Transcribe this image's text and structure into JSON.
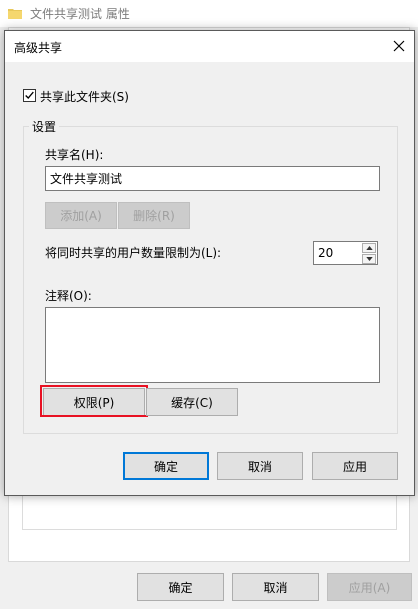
{
  "background": {
    "title": "文件共享测试 属性",
    "buttons": {
      "ok": "确定",
      "cancel": "取消",
      "apply": "应用(A)"
    }
  },
  "dialog": {
    "title": "高级共享",
    "share_checkbox_label": "共享此文件夹(S)",
    "share_checked": true,
    "settings_label": "设置",
    "share_name_label": "共享名(H):",
    "share_name_value": "文件共享测试",
    "add_button": "添加(A)",
    "remove_button": "删除(R)",
    "user_limit_label": "将同时共享的用户数量限制为(L):",
    "user_limit_value": "20",
    "comment_label": "注释(O):",
    "comment_value": "",
    "permissions_button": "权限(P)",
    "cache_button": "缓存(C)",
    "ok_button": "确定",
    "cancel_button": "取消",
    "apply_button": "应用"
  },
  "colors": {
    "accent": "#0078d7",
    "highlight": "#e81123"
  },
  "icons": {
    "folder": "folder-icon",
    "close": "close-icon",
    "check": "check-icon",
    "up": "arrow-up-icon",
    "down": "arrow-down-icon"
  }
}
